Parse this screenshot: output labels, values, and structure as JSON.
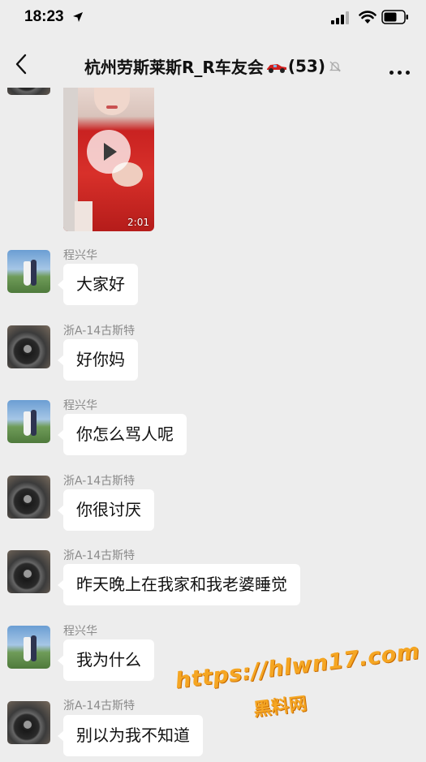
{
  "status_bar": {
    "time": "18:23"
  },
  "nav": {
    "title": "杭州劳斯莱斯R_R车友会",
    "member_count": "(53)"
  },
  "video": {
    "duration": "2:01"
  },
  "messages": [
    {
      "sender": "程兴华",
      "text": "大家好",
      "avatar": "avatar-a"
    },
    {
      "sender": "浙A-14古斯特",
      "text": "好你妈",
      "avatar": "avatar-b"
    },
    {
      "sender": "程兴华",
      "text": "你怎么骂人呢",
      "avatar": "avatar-a"
    },
    {
      "sender": "浙A-14古斯特",
      "text": "你很讨厌",
      "avatar": "avatar-b"
    },
    {
      "sender": "浙A-14古斯特",
      "text": "昨天晚上在我家和我老婆睡觉",
      "avatar": "avatar-b"
    },
    {
      "sender": "程兴华",
      "text": "我为什么",
      "avatar": "avatar-a"
    },
    {
      "sender": "浙A-14古斯特",
      "text": "别以为我不知道",
      "avatar": "avatar-b"
    }
  ],
  "watermark": {
    "url": "https://hlwn17.com",
    "name": "黑料网"
  },
  "colors": {
    "background": "#ededed",
    "bubble": "#ffffff",
    "watermark": "#f5a623"
  }
}
